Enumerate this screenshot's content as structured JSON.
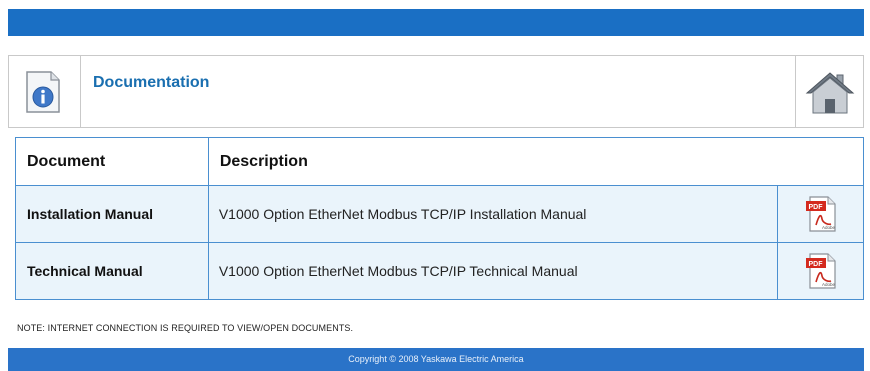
{
  "header": {
    "title": "Documentation",
    "info_icon": "info-document-icon",
    "home_icon": "home-icon"
  },
  "table": {
    "columns": [
      "Document",
      "Description"
    ],
    "rows": [
      {
        "document": "Installation Manual",
        "description": "V1000 Option EtherNet Modbus TCP/IP Installation Manual",
        "icon": "pdf-icon"
      },
      {
        "document": "Technical Manual",
        "description": "V1000 Option EtherNet Modbus TCP/IP Technical Manual",
        "icon": "pdf-icon"
      }
    ]
  },
  "note": "NOTE: INTERNET CONNECTION IS REQUIRED TO VIEW/OPEN DOCUMENTS.",
  "footer": {
    "copyright": "Copyright © 2008 Yaskawa Electric America"
  },
  "colors": {
    "top_bar": "#1a6fc4",
    "title": "#1a6fb0",
    "table_border": "#4a8fd0",
    "row_bg": "#eaf4fb",
    "footer": "#2a73c8"
  }
}
